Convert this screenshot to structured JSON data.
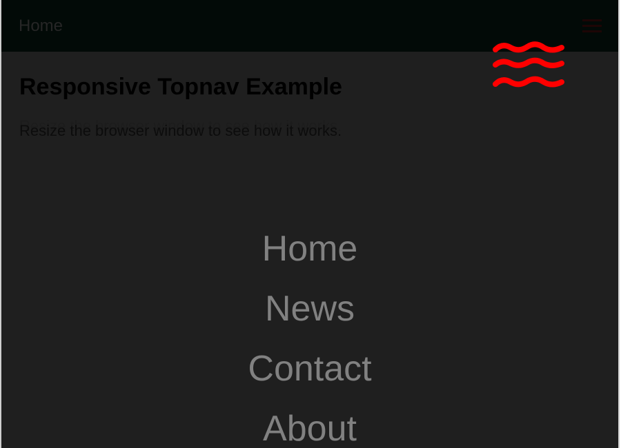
{
  "topnav": {
    "home_label": "Home",
    "menu_icon": "hamburger-icon"
  },
  "content": {
    "title": "Responsive Topnav Example",
    "text": "Resize the browser window to see how it works."
  },
  "overlay": {
    "close_icon": "close-icon",
    "close_color": "#ff0000",
    "links": [
      {
        "label": "Home"
      },
      {
        "label": "News"
      },
      {
        "label": "Contact"
      },
      {
        "label": "About"
      }
    ]
  }
}
